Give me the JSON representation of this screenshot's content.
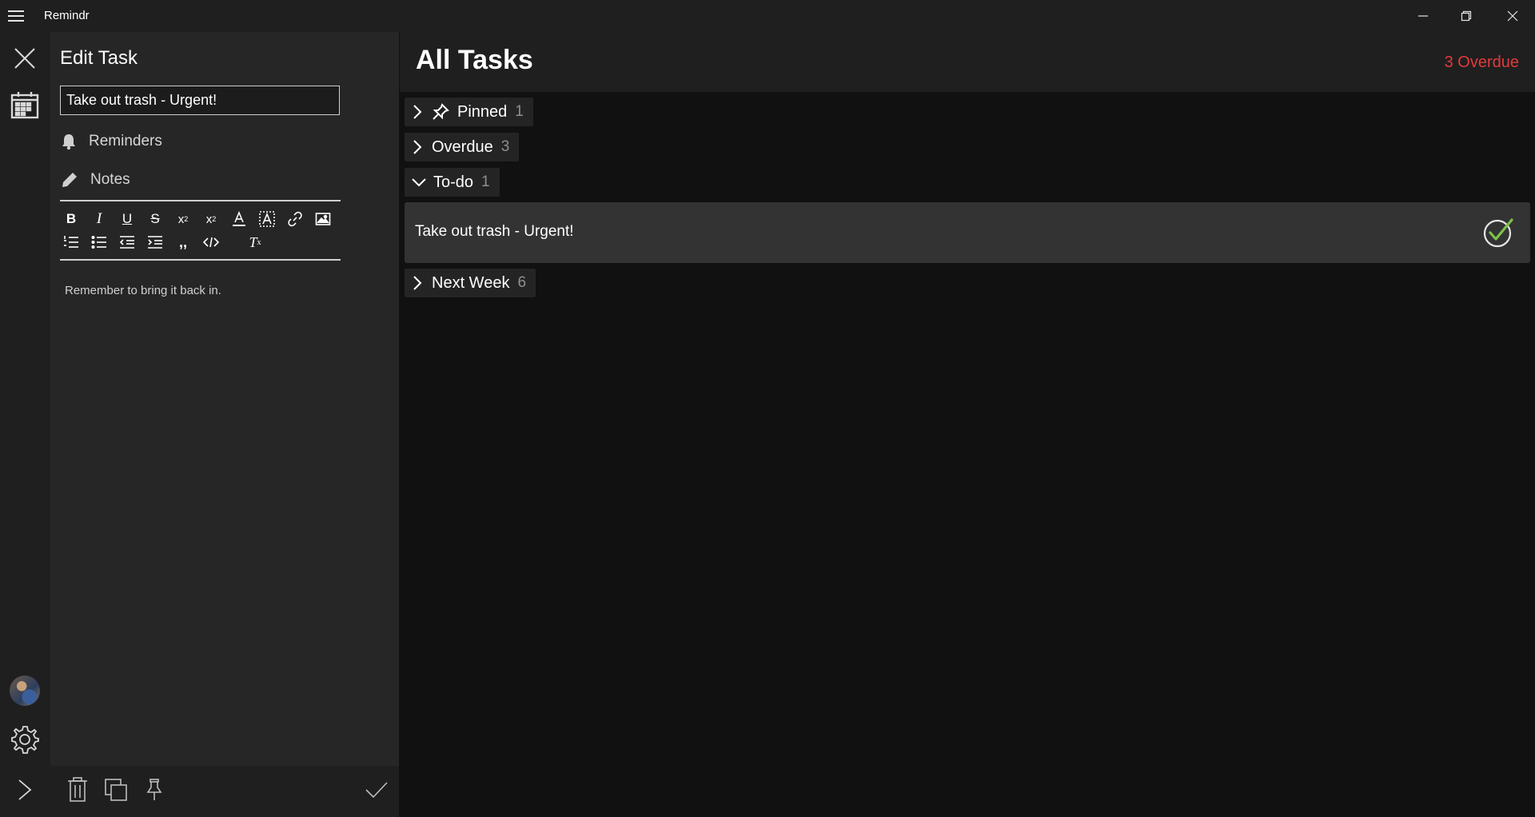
{
  "app": {
    "title": "Remindr"
  },
  "edit": {
    "title": "Edit Task",
    "task_name": "Take out trash - Urgent!",
    "reminders_label": "Reminders",
    "notes_label": "Notes",
    "notes_text": "Remember to bring it back in.",
    "toolbar_row1": [
      "bold",
      "italic",
      "underline",
      "strikethrough",
      "subscript",
      "superscript",
      "font-color",
      "highlight",
      "link",
      "image"
    ],
    "toolbar_row2": [
      "numbered-list",
      "bulleted-list",
      "outdent",
      "indent",
      "quote",
      "code",
      "clear-formatting"
    ]
  },
  "main": {
    "title": "All Tasks",
    "overdue_badge": "3 Overdue",
    "groups": [
      {
        "name": "Pinned",
        "count": "1",
        "expanded": false,
        "icon": "pin-icon"
      },
      {
        "name": "Overdue",
        "count": "3",
        "expanded": false
      },
      {
        "name": "To-do",
        "count": "1",
        "expanded": true
      },
      {
        "name": "Next Week",
        "count": "6",
        "expanded": false
      }
    ],
    "tasks": [
      {
        "title": "Take out trash - Urgent!",
        "group": "To-do"
      }
    ]
  },
  "colors": {
    "overdue": "#e23a3a",
    "check_accent": "#7dc24a",
    "panel_bg": "#262626",
    "main_bg": "#111111"
  }
}
